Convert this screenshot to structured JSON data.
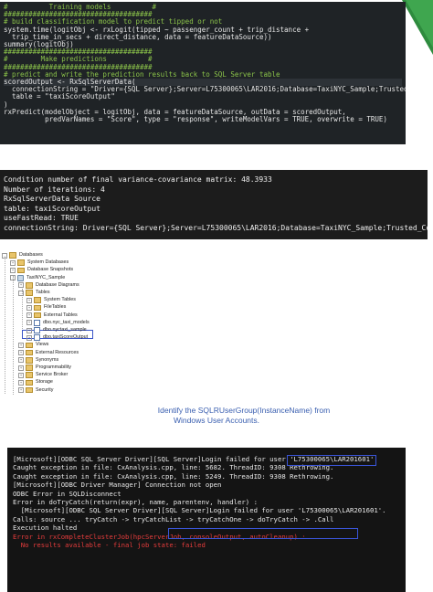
{
  "code_panel": {
    "lines": [
      {
        "text": "#          Training models          #",
        "kind": "comment"
      },
      {
        "text": "####################################",
        "kind": "comment"
      },
      {
        "text": "# build classification model to predict tipped or not",
        "kind": "comment"
      },
      {
        "text": "system.time(logitObj <- rxLogit(tipped ~ passenger_count + trip_distance +",
        "kind": "code"
      },
      {
        "text": "  trip_time_in_secs + direct_distance, data = featureDataSource))",
        "kind": "code"
      },
      {
        "text": "summary(logitObj)",
        "kind": "code"
      },
      {
        "text": "",
        "kind": "code"
      },
      {
        "text": "####################################",
        "kind": "comment"
      },
      {
        "text": "#        Make predictions          #",
        "kind": "comment"
      },
      {
        "text": "####################################",
        "kind": "comment"
      },
      {
        "text": "# predict and write the prediction results back to SQL Server table",
        "kind": "comment"
      },
      {
        "text": "scoredOutput <- RxSqlServerData(",
        "kind": "code"
      },
      {
        "text": "  connectionString = \"Driver={SQL Server};Server=L75300065\\LAR2016;Database=TaxiNYC_Sample;Trusted_Connection=yes\",",
        "kind": "string"
      },
      {
        "text": "  table = \"taxiScoreOutput\"",
        "kind": "string"
      },
      {
        "text": ")",
        "kind": "code"
      },
      {
        "text": "",
        "kind": "code"
      },
      {
        "text": "rxPredict(modelObject = logitObj, data = featureDataSource, outData = scoredOutput,",
        "kind": "code"
      },
      {
        "text": "          predVarNames = \"Score\", type = \"response\", writeModelVars = TRUE, overwrite = TRUE)",
        "kind": "code"
      }
    ]
  },
  "console_panel": {
    "lines": [
      "Condition number of final variance-covariance matrix: 48.3933",
      "Number of iterations: 4",
      "RxSqlServerData Source",
      "table: taxiScoreOutput",
      "useFastRead: TRUE",
      "connectionString: Driver={SQL Server};Server=L75300065\\LAR2016;Database=TaxiNYC_Sample;Trusted_Connection=yes"
    ]
  },
  "object_explorer": {
    "nodes": [
      {
        "label": "Databases",
        "icon": "folder-icon",
        "depth": 0,
        "expander": "-"
      },
      {
        "label": "System Databases",
        "icon": "folder-icon",
        "depth": 1,
        "expander": "+"
      },
      {
        "label": "Database Snapshots",
        "icon": "folder-icon",
        "depth": 1,
        "expander": "+"
      },
      {
        "label": "TaxiNYC_Sample",
        "icon": "database-icon",
        "depth": 1,
        "expander": "-"
      },
      {
        "label": "Database Diagrams",
        "icon": "folder-icon",
        "depth": 2,
        "expander": "+"
      },
      {
        "label": "Tables",
        "icon": "folder-icon",
        "depth": 2,
        "expander": "-"
      },
      {
        "label": "System Tables",
        "icon": "folder-icon",
        "depth": 3,
        "expander": "+"
      },
      {
        "label": "FileTables",
        "icon": "folder-icon",
        "depth": 3,
        "expander": "+"
      },
      {
        "label": "External Tables",
        "icon": "folder-icon",
        "depth": 3,
        "expander": "+"
      },
      {
        "label": "dbo.nyc_taxi_models",
        "icon": "table-icon",
        "depth": 3,
        "expander": "+"
      },
      {
        "label": "dbo.nyctaxi_sample",
        "icon": "table-icon",
        "depth": 3,
        "expander": "+"
      },
      {
        "label": "dbo.taxiScoreOutput",
        "icon": "table-icon",
        "depth": 3,
        "expander": "+"
      },
      {
        "label": "Views",
        "icon": "folder-icon",
        "depth": 2,
        "expander": "+"
      },
      {
        "label": "External Resources",
        "icon": "folder-icon",
        "depth": 2,
        "expander": "+"
      },
      {
        "label": "Synonyms",
        "icon": "folder-icon",
        "depth": 2,
        "expander": "+"
      },
      {
        "label": "Programmability",
        "icon": "folder-icon",
        "depth": 2,
        "expander": "+"
      },
      {
        "label": "Service Broker",
        "icon": "folder-icon",
        "depth": 2,
        "expander": "+"
      },
      {
        "label": "Storage",
        "icon": "folder-icon",
        "depth": 2,
        "expander": "+"
      },
      {
        "label": "Security",
        "icon": "folder-icon",
        "depth": 2,
        "expander": "+"
      }
    ],
    "selected": "dbo.taxiScoreOutput"
  },
  "caption": {
    "line1": "Identify the SQLRUserGroup(InstanceName) from",
    "line2": "Windows User Accounts."
  },
  "error_panel": {
    "lines": [
      {
        "text": "[Microsoft][ODBC SQL Server Driver][SQL Server]Login failed for user 'L75300065\\LAR201601'.",
        "kind": "normal"
      },
      {
        "text": "Caught exception in file: CxAnalysis.cpp, line: 5682. ThreadID: 9308 Rethrowing.",
        "kind": "normal"
      },
      {
        "text": "Caught exception in file: CxAnalysis.cpp, line: 5249. ThreadID: 9308 Rethrowing.",
        "kind": "normal"
      },
      {
        "text": "",
        "kind": "normal"
      },
      {
        "text": "[Microsoft][ODBC Driver Manager] Connection not open",
        "kind": "normal"
      },
      {
        "text": "",
        "kind": "normal"
      },
      {
        "text": "ODBC Error in SQLDisconnect",
        "kind": "normal"
      },
      {
        "text": "Error in doTryCatch(return(expr), name, parentenv, handler) :",
        "kind": "normal"
      },
      {
        "text": "  [Microsoft][ODBC SQL Server Driver][SQL Server]Login failed for user 'L75300065\\LAR201601'.",
        "kind": "normal"
      },
      {
        "text": "Calls: source ... tryCatch -> tryCatchList -> tryCatchOne -> doTryCatch -> .Call",
        "kind": "normal"
      },
      {
        "text": "Execution halted",
        "kind": "normal"
      },
      {
        "text": "Error in rxCompleteClusterJob(hpcServerJob, consoleOutput, autoCleanup) :",
        "kind": "red"
      },
      {
        "text": "  No results available - final job state: failed",
        "kind": "red"
      }
    ]
  },
  "colors": {
    "accent_triangle": "#2e8b3e",
    "highlight_box": "#3a55d8",
    "error_text": "#e63c3c"
  }
}
